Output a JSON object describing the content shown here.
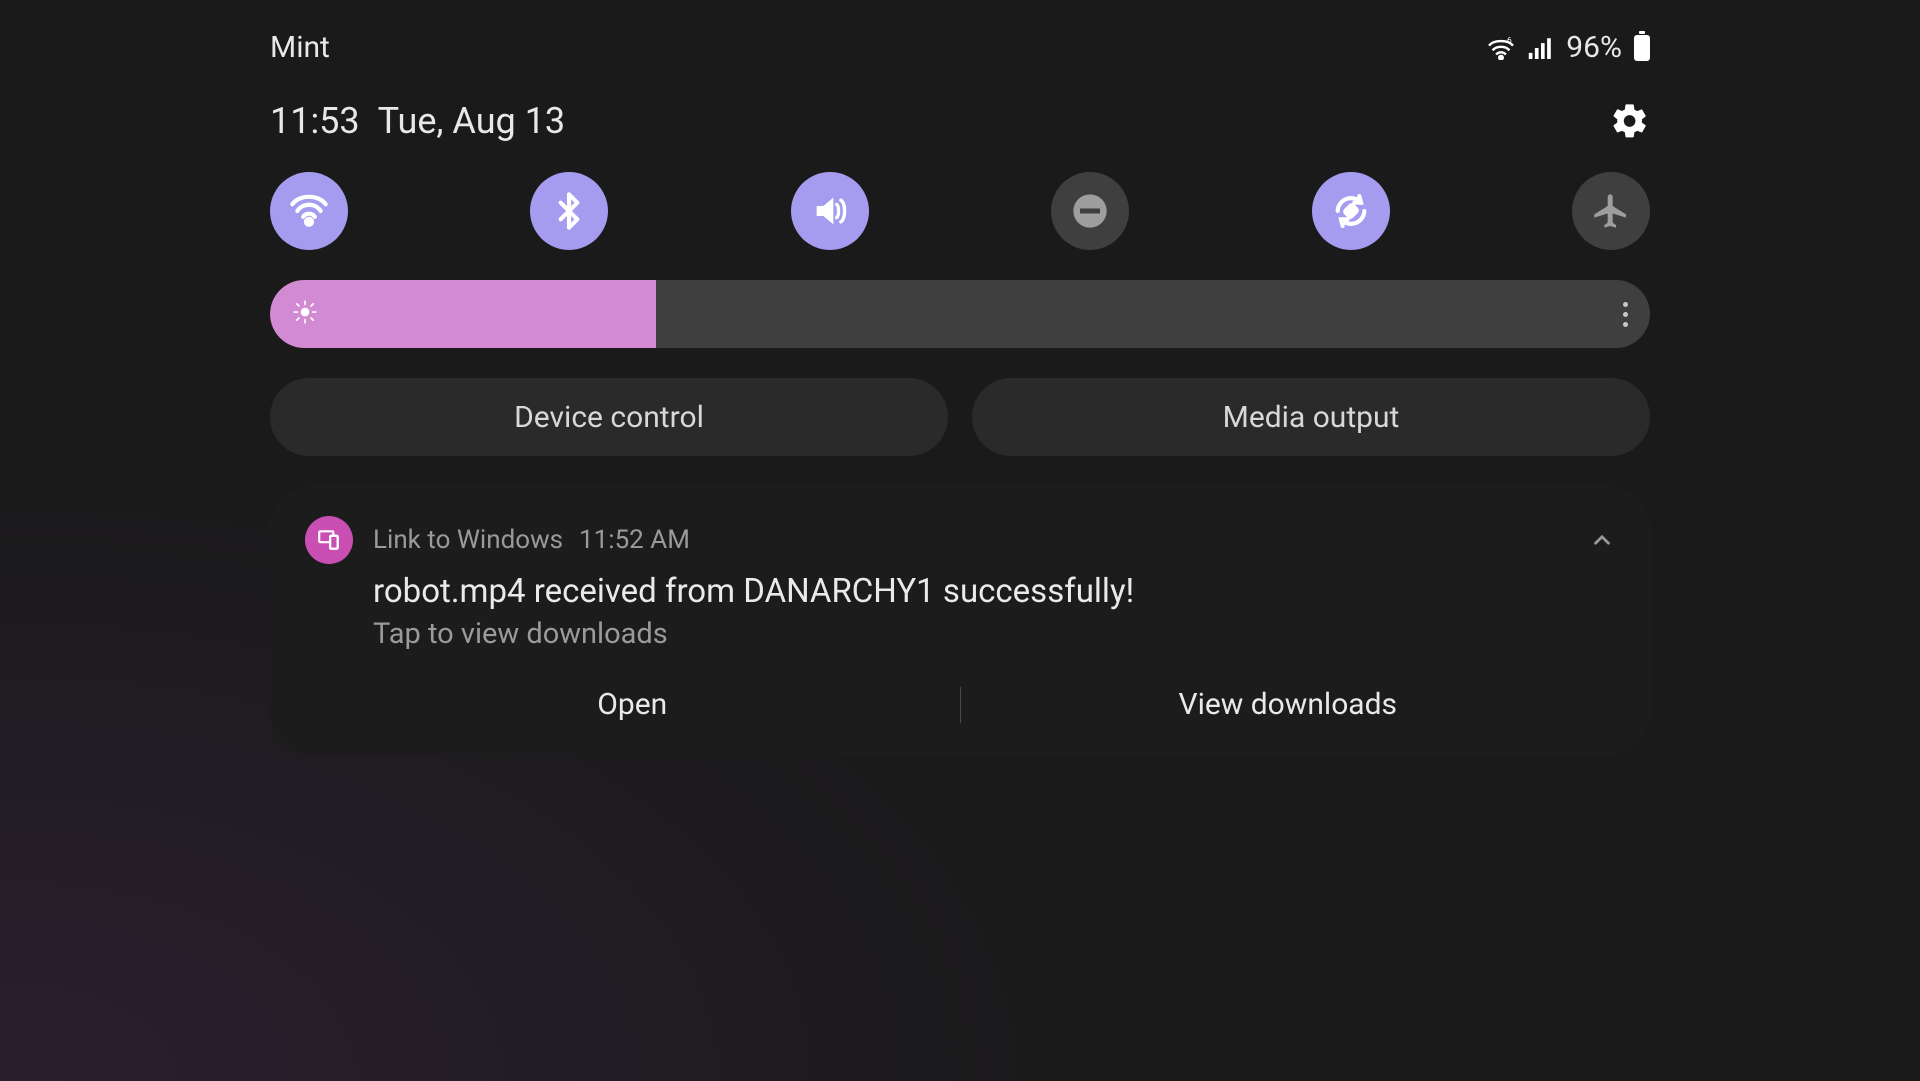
{
  "status_bar": {
    "carrier": "Mint",
    "battery_percent": "96%"
  },
  "header": {
    "time": "11:53",
    "date": "Tue, Aug 13"
  },
  "quick_toggles": [
    {
      "name": "wifi",
      "on": true
    },
    {
      "name": "bluetooth",
      "on": true
    },
    {
      "name": "sound",
      "on": true
    },
    {
      "name": "dnd",
      "on": false
    },
    {
      "name": "rotate",
      "on": true
    },
    {
      "name": "airplane",
      "on": false
    }
  ],
  "brightness": {
    "percent": 28
  },
  "pills": {
    "device_control": "Device control",
    "media_output": "Media output"
  },
  "notification": {
    "app": "Link to Windows",
    "time": "11:52 AM",
    "title": "robot.mp4 received from DANARCHY1 successfully!",
    "subtitle": "Tap to view downloads",
    "actions": {
      "open": "Open",
      "view": "View downloads"
    }
  }
}
